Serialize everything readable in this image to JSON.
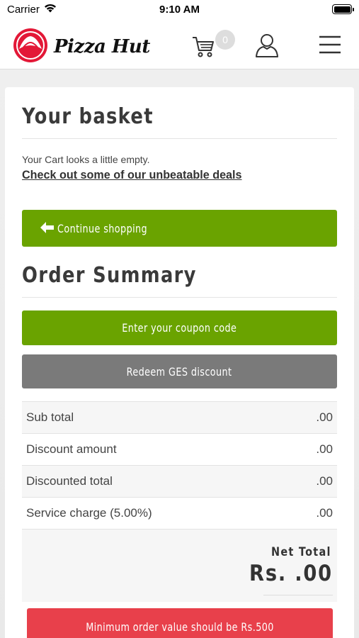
{
  "status_bar": {
    "carrier": "Carrier",
    "time": "9:10 AM"
  },
  "header": {
    "brand": "Pizza Hut",
    "cart_count": "0",
    "brand_color": "#e31837"
  },
  "basket": {
    "title": "Your basket",
    "empty_message": "Your Cart looks a little empty.",
    "deals_link": "Check out some of our unbeatable deals",
    "continue_button": "Continue shopping"
  },
  "order_summary": {
    "title": "Order Summary",
    "coupon_button": "Enter your coupon code",
    "ges_button": "Redeem GES discount",
    "rows": [
      {
        "label": "Sub total",
        "value": ".00"
      },
      {
        "label": "Discount amount",
        "value": ".00"
      },
      {
        "label": "Discounted total",
        "value": ".00"
      },
      {
        "label": "Service charge (5.00%)",
        "value": ".00"
      }
    ],
    "net_total_label": "Net Total",
    "net_total_value": "Rs. .00",
    "min_order_button": "Minimum order value should be Rs.500"
  },
  "colors": {
    "green": "#6aa300",
    "gray_button": "#7a7a7a",
    "red_button": "#e8404b"
  },
  "icons": [
    "wifi-icon",
    "battery-icon",
    "pizza-hut-logo-icon",
    "cart-icon",
    "user-icon",
    "hamburger-menu-icon",
    "arrow-left-icon"
  ]
}
